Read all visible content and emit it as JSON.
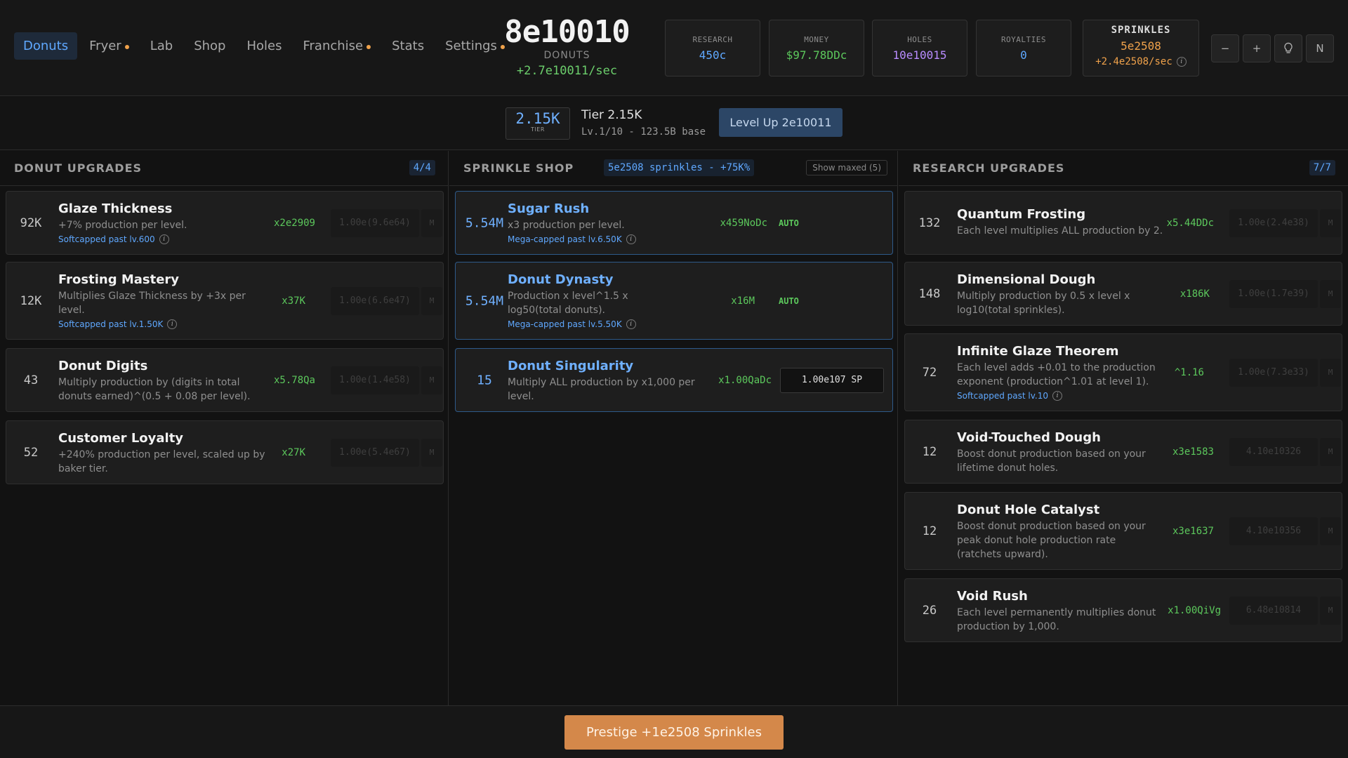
{
  "nav": {
    "items": [
      {
        "label": "Donuts",
        "active": true,
        "dot": false
      },
      {
        "label": "Fryer",
        "active": false,
        "dot": true
      },
      {
        "label": "Lab",
        "active": false,
        "dot": false
      },
      {
        "label": "Shop",
        "active": false,
        "dot": false
      },
      {
        "label": "Holes",
        "active": false,
        "dot": false
      },
      {
        "label": "Franchise",
        "active": false,
        "dot": true
      },
      {
        "label": "Stats",
        "active": false,
        "dot": false
      },
      {
        "label": "Settings",
        "active": false,
        "dot": true
      }
    ]
  },
  "header": {
    "donuts": "8e10010",
    "donuts_label": "DONUTS",
    "rate": "+2.7e10011/sec"
  },
  "stats": {
    "research": {
      "label": "RESEARCH",
      "value": "450c",
      "color": "#5fa8ff"
    },
    "money": {
      "label": "MONEY",
      "value": "$97.78DDc",
      "color": "#5cc85c"
    },
    "holes": {
      "label": "HOLES",
      "value": "10e10015",
      "color": "#b98cff"
    },
    "royalties": {
      "label": "ROYALTIES",
      "value": "0",
      "color": "#5fa8ff"
    },
    "sprinkles": {
      "label": "SPRINKLES",
      "value": "5e2508",
      "rate": "+2.4e2508/sec"
    }
  },
  "controls": {
    "minus": "−",
    "plus": "+",
    "bulb_icon": "lightbulb-icon",
    "notation": "N"
  },
  "tier": {
    "badge_value": "2.15K",
    "badge_label": "TIER",
    "title": "Tier 2.15K",
    "subtitle": "Lv.1/10 - 123.5B base",
    "level_up": "Level Up 2e10011"
  },
  "donut_upgrades": {
    "title": "DONUT UPGRADES",
    "count": "4/4",
    "items": [
      {
        "level": "92K",
        "name": "Glaze Thickness",
        "desc": "+7% production per level.",
        "cap": "Softcapped past lv.600",
        "mult": "x2e2909",
        "cost": "1.00e(9.6e64)",
        "max": "M"
      },
      {
        "level": "12K",
        "name": "Frosting Mastery",
        "desc": "Multiplies Glaze Thickness by +3x per level.",
        "cap": "Softcapped past lv.1.50K",
        "mult": "x37K",
        "cost": "1.00e(6.6e47)",
        "max": "M"
      },
      {
        "level": "43",
        "name": "Donut Digits",
        "desc": "Multiply production by (digits in total donuts earned)^(0.5 + 0.08 per level).",
        "cap": "",
        "mult": "x5.78Qa",
        "cost": "1.00e(1.4e58)",
        "max": "M"
      },
      {
        "level": "52",
        "name": "Customer Loyalty",
        "desc": "+240% production per level, scaled up by baker tier.",
        "cap": "",
        "mult": "x27K",
        "cost": "1.00e(5.4e67)",
        "max": "M"
      }
    ]
  },
  "sprinkle_shop": {
    "title": "SPRINKLE SHOP",
    "info": "5e2508 sprinkles - +75K%",
    "show_maxed": "Show maxed (5)",
    "items": [
      {
        "level": "5.54M",
        "name": "Sugar Rush",
        "desc": "x3 production per level.",
        "cap": "Mega-capped past lv.6.50K",
        "mult": "x459NoDc",
        "auto": "AUTO"
      },
      {
        "level": "5.54M",
        "name": "Donut Dynasty",
        "desc": "Production x level^1.5 x log50(total donuts).",
        "cap": "Mega-capped past lv.5.50K",
        "mult": "x16M",
        "auto": "AUTO"
      },
      {
        "level": "15",
        "name": "Donut Singularity",
        "desc": "Multiply ALL production by x1,000 per level.",
        "cap": "",
        "mult": "x1.00QaDc",
        "buy": "1.00e107 SP"
      }
    ]
  },
  "research_upgrades": {
    "title": "RESEARCH UPGRADES",
    "count": "7/7",
    "items": [
      {
        "level": "132",
        "name": "Quantum Frosting",
        "desc": "Each level multiplies ALL production by 2.",
        "cap": "",
        "mult": "x5.44DDc",
        "cost": "1.00e(2.4e38)",
        "max": "M"
      },
      {
        "level": "148",
        "name": "Dimensional Dough",
        "desc": "Multiply production by 0.5 x level x log10(total sprinkles).",
        "cap": "",
        "mult": "x186K",
        "cost": "1.00e(1.7e39)",
        "max": "M"
      },
      {
        "level": "72",
        "name": "Infinite Glaze Theorem",
        "desc": "Each level adds +0.01 to the production exponent (production^1.01 at level 1).",
        "cap": "Softcapped past lv.10",
        "mult": "^1.16",
        "cost": "1.00e(7.3e33)",
        "max": "M"
      },
      {
        "level": "12",
        "name": "Void-Touched Dough",
        "desc": "Boost donut production based on your lifetime donut holes.",
        "cap": "",
        "mult": "x3e1583",
        "cost": "4.10e10326",
        "max": "M"
      },
      {
        "level": "12",
        "name": "Donut Hole Catalyst",
        "desc": "Boost donut production based on your peak donut hole production rate (ratchets upward).",
        "cap": "",
        "mult": "x3e1637",
        "cost": "4.10e10356",
        "max": "M"
      },
      {
        "level": "26",
        "name": "Void Rush",
        "desc": "Each level permanently multiplies donut production by 1,000.",
        "cap": "",
        "mult": "x1.00QiVg",
        "cost": "6.48e10814",
        "max": "M"
      }
    ]
  },
  "footer": {
    "prestige": "Prestige +1e2508 Sprinkles"
  }
}
